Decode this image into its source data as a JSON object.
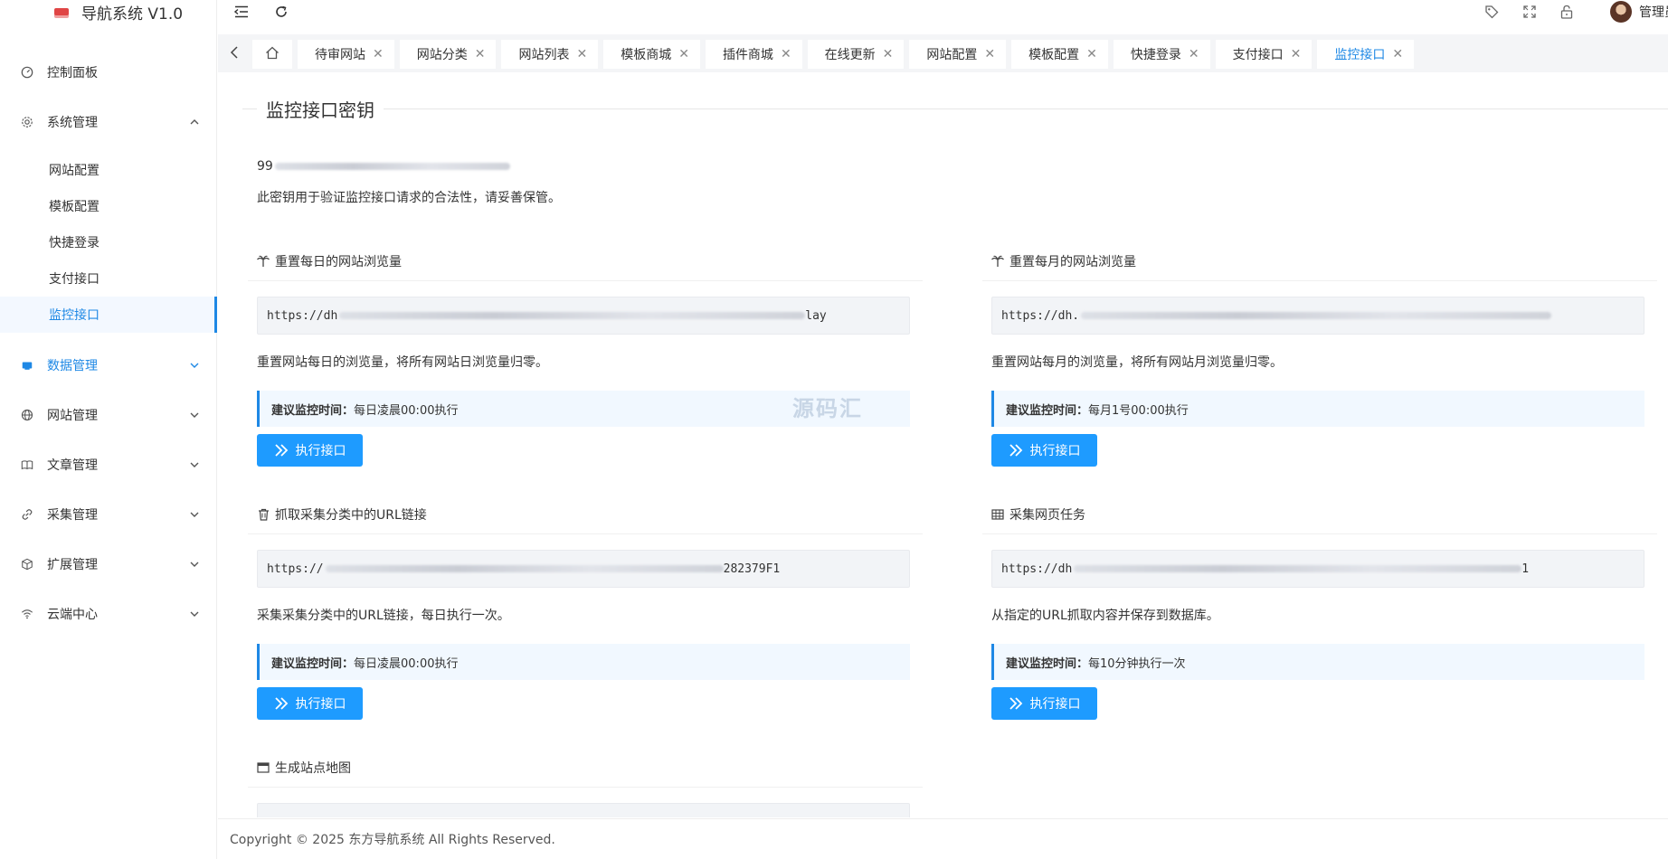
{
  "app": {
    "title": "导航系统 V1.0"
  },
  "header": {
    "admin_name": "管理员"
  },
  "sidebar": {
    "items": [
      {
        "label": "控制面板"
      },
      {
        "label": "系统管理"
      },
      {
        "label": "数据管理"
      },
      {
        "label": "网站管理"
      },
      {
        "label": "文章管理"
      },
      {
        "label": "采集管理"
      },
      {
        "label": "扩展管理"
      },
      {
        "label": "云端中心"
      }
    ],
    "system_sub": [
      "网站配置",
      "模板配置",
      "快捷登录",
      "支付接口",
      "监控接口"
    ]
  },
  "tabs": [
    "待审网站",
    "网站分类",
    "网站列表",
    "模板商城",
    "插件商城",
    "在线更新",
    "网站配置",
    "模板配置",
    "快捷登录",
    "支付接口",
    "监控接口"
  ],
  "content": {
    "section_title": "监控接口密钥",
    "key_prefix": "99",
    "key_desc": "此密钥用于验证监控接口请求的合法性，请妥善保管。",
    "tip_label": "建议监控时间：",
    "button_label": "执行接口",
    "cards": [
      {
        "title": "重置每日的网站浏览量",
        "url_start": "https://dh",
        "url_end": "lay",
        "desc": "重置网站每日的浏览量，将所有网站日浏览量归零。",
        "tip": "每日凌晨00:00执行"
      },
      {
        "title": "重置每月的网站浏览量",
        "url_start": "https://dh.",
        "url_end": "",
        "desc": "重置网站每月的浏览量，将所有网站月浏览量归零。",
        "tip": "每月1号00:00执行"
      },
      {
        "title": "抓取采集分类中的URL链接",
        "url_start": "https://",
        "url_end": "282379F1",
        "desc": "采集采集分类中的URL链接，每日执行一次。",
        "tip": "每日凌晨00:00执行"
      },
      {
        "title": "采集网页任务",
        "url_start": "https://dh",
        "url_end": "1",
        "desc": "从指定的URL抓取内容并保存到数据库。",
        "tip": "每10分钟执行一次"
      },
      {
        "title": "生成站点地图"
      }
    ]
  },
  "watermark": "源码汇",
  "footer": {
    "text": "Copyright © 2025 东方导航系统 All Rights Reserved."
  }
}
